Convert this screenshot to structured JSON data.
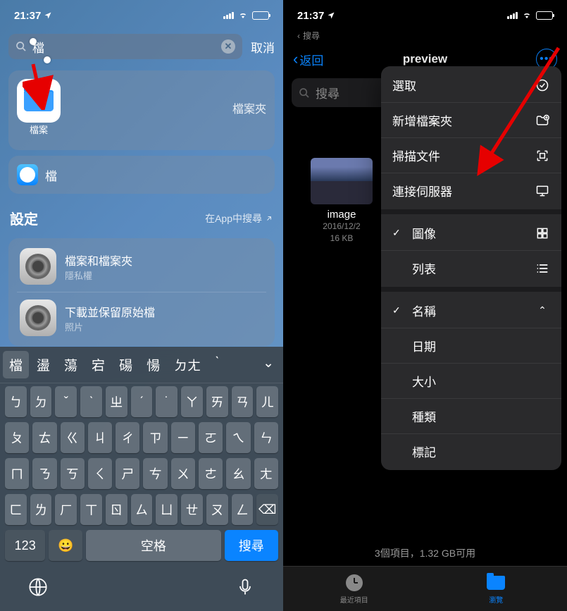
{
  "left": {
    "status": {
      "time": "21:37"
    },
    "search": {
      "value": "檔",
      "cancel": "取消"
    },
    "app": {
      "name": "檔案",
      "category": "檔案夾"
    },
    "safari": {
      "label": "檔"
    },
    "settings": {
      "header": "設定",
      "link": "在App中搜尋",
      "items": [
        {
          "title": "檔案和檔案夾",
          "sub": "隱私權"
        },
        {
          "title": "下載並保留原始檔",
          "sub": "照片"
        }
      ]
    },
    "keyboard": {
      "candidates": [
        "檔",
        "盪",
        "蕩",
        "宕",
        "碭",
        "愓",
        "ㄉㄤ",
        "ˋ"
      ],
      "rows": [
        [
          "ㄅ",
          "ㄉ",
          "ˇ",
          "ˋ",
          "ㄓ",
          "ˊ",
          "˙",
          "ㄚ",
          "ㄞ",
          "ㄢ",
          "ㄦ"
        ],
        [
          "ㄆ",
          "ㄊ",
          "ㄍ",
          "ㄐ",
          "ㄔ",
          "ㄗ",
          "ㄧ",
          "ㄛ",
          "ㄟ",
          "ㄣ"
        ],
        [
          "ㄇ",
          "ㄋ",
          "ㄎ",
          "ㄑ",
          "ㄕ",
          "ㄘ",
          "ㄨ",
          "ㄜ",
          "ㄠ",
          "ㄤ"
        ],
        [
          "ㄈ",
          "ㄌ",
          "ㄏ",
          "ㄒ",
          "ㄖ",
          "ㄙ",
          "ㄩ",
          "ㄝ",
          "ㄡ",
          "ㄥ"
        ]
      ],
      "num": "123",
      "space": "空格",
      "search": "搜尋"
    }
  },
  "right": {
    "status": {
      "time": "21:37"
    },
    "breadcrumb": "搜尋",
    "nav": {
      "back": "返回",
      "title": "preview"
    },
    "search_placeholder": "搜尋",
    "file": {
      "name": "image",
      "date": "2016/12/2",
      "size": "16 KB"
    },
    "menu": {
      "g1": [
        {
          "label": "選取",
          "icon": "check-circle"
        },
        {
          "label": "新增檔案夾",
          "icon": "folder-plus"
        },
        {
          "label": "掃描文件",
          "icon": "scan"
        },
        {
          "label": "連接伺服器",
          "icon": "monitor"
        }
      ],
      "g2": [
        {
          "label": "圖像",
          "icon": "grid",
          "checked": true
        },
        {
          "label": "列表",
          "icon": "list"
        }
      ],
      "g3": [
        {
          "label": "名稱",
          "checked": true,
          "expand": true
        },
        {
          "label": "日期"
        },
        {
          "label": "大小"
        },
        {
          "label": "種類"
        },
        {
          "label": "標記"
        }
      ]
    },
    "footer": "3個項目，1.32 GB可用",
    "tabs": [
      {
        "label": "最近項目",
        "icon": "clock"
      },
      {
        "label": "瀏覽",
        "icon": "folder",
        "active": true
      }
    ]
  }
}
